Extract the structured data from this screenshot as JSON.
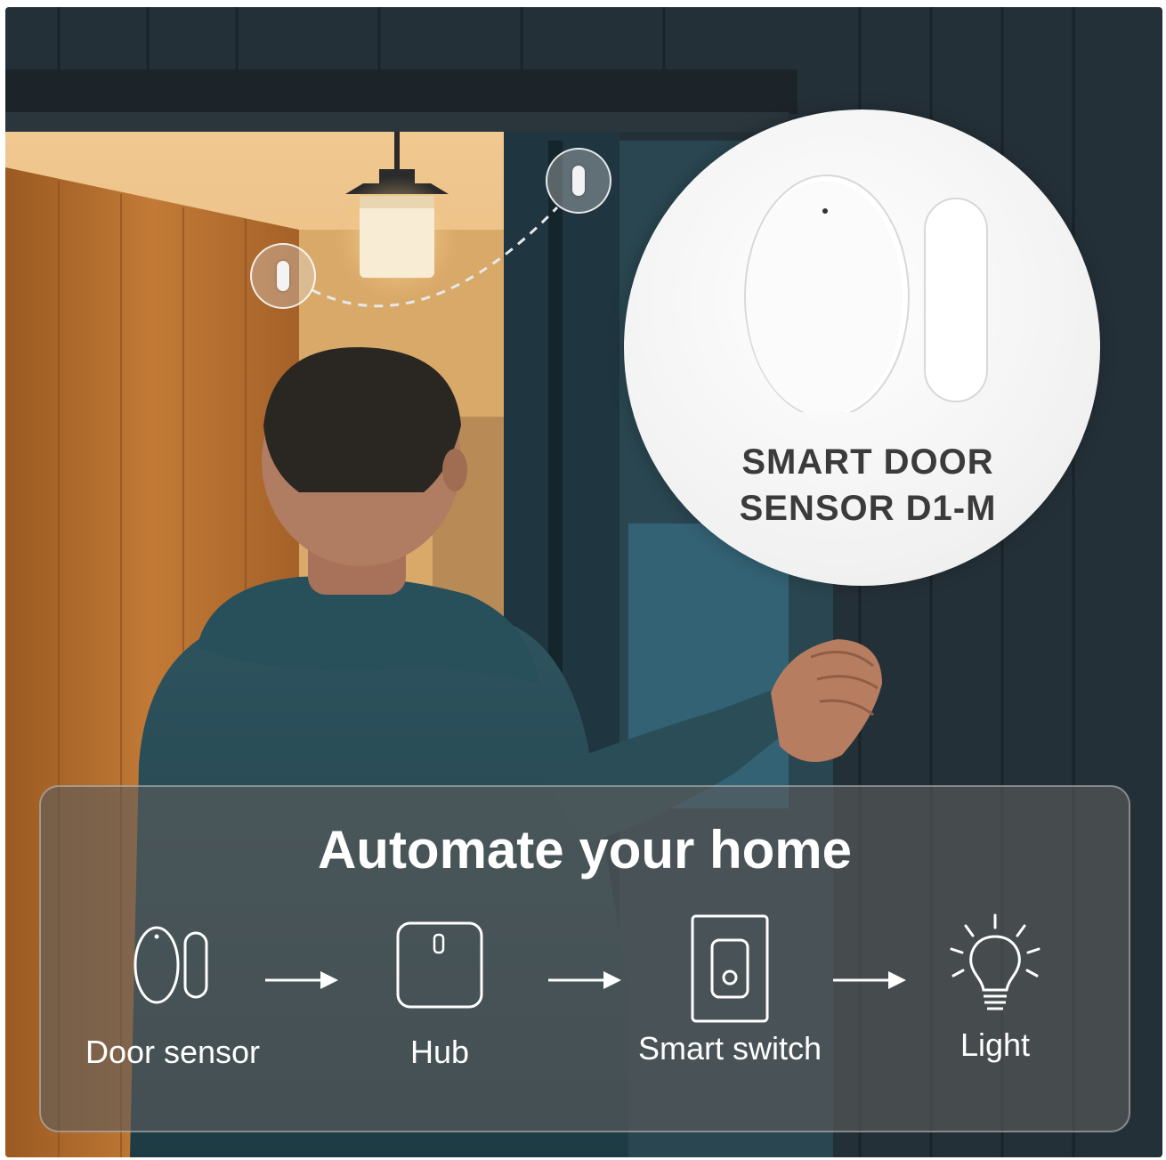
{
  "product": {
    "name_line1": "SMART DOOR",
    "name_line2": "SENSOR D1-M"
  },
  "automation": {
    "title": "Automate your home",
    "steps": [
      {
        "label": "Door sensor",
        "icon": "door-sensor-icon"
      },
      {
        "label": "Hub",
        "icon": "hub-icon"
      },
      {
        "label": "Smart switch",
        "icon": "smart-switch-icon"
      },
      {
        "label": "Light",
        "icon": "light-bulb-icon"
      }
    ],
    "connector_icon": "arrow-right-icon"
  },
  "colors": {
    "panel_background": "#5c5c5c",
    "text_on_panel": "#ffffff",
    "product_text": "#3b3b3b",
    "exterior_wall": "#24343c",
    "interior_wood": "#b06a2c"
  }
}
